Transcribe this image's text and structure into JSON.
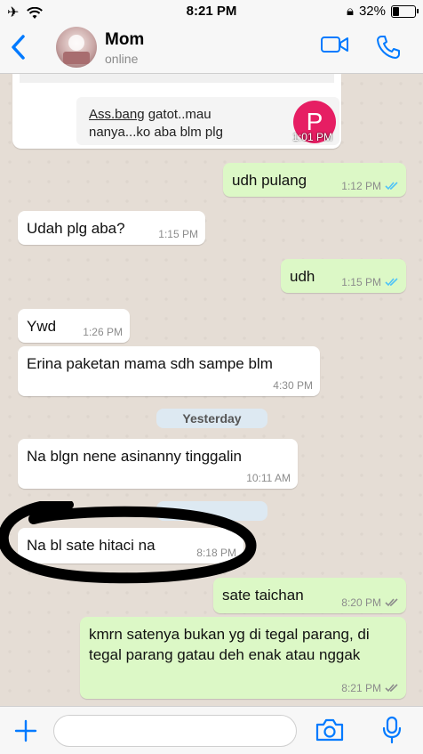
{
  "status_bar": {
    "time": "8:21 PM",
    "battery": "32%",
    "battery_level": 0.32
  },
  "header": {
    "contact_name": "Mom",
    "contact_status": "online"
  },
  "forwarded_card": {
    "link_text": "Ass.bang",
    "text_rest": " gatot..mau nanya...ko aba blm plg",
    "time": "1:01 PM",
    "logo_letter": "P"
  },
  "messages": [
    {
      "text": "udh pulang",
      "time": "1:12 PM",
      "dir": "out"
    },
    {
      "text": "Udah plg aba?",
      "time": "1:15 PM",
      "dir": "in"
    },
    {
      "text": "udh",
      "time": "1:15 PM",
      "dir": "out"
    },
    {
      "text": "Ywd",
      "time": "1:26 PM",
      "dir": "in"
    },
    {
      "text": "Erina paketan mama sdh sampe blm",
      "time": "4:30 PM",
      "dir": "in"
    },
    {
      "text": "Na blgn nene asinanny tinggalin",
      "time": "10:11 AM",
      "dir": "in"
    },
    {
      "text": "Na bl sate hitaci na",
      "time": "8:18 PM",
      "dir": "in"
    },
    {
      "text": "sate taichan",
      "time": "8:20 PM",
      "dir": "out"
    },
    {
      "text": "kmrn satenya bukan yg di tegal parang, di tegal parang gatau deh enak atau nggak",
      "time": "8:21 PM",
      "dir": "out"
    }
  ],
  "date_separator": "Yesterday",
  "icons": {
    "airplane": "airplane-icon",
    "wifi": "wifi-icon",
    "lock_rotation": "orientation-lock-icon",
    "back": "chevron-left-icon",
    "video": "video-call-icon",
    "phone": "phone-icon",
    "add": "plus-icon",
    "camera": "camera-icon",
    "mic": "microphone-icon"
  },
  "colors": {
    "accent": "#007aff",
    "outgoing_bubble": "#dcf8c6",
    "incoming_bubble": "#ffffff",
    "read_ticks": "#4fc3f7"
  }
}
